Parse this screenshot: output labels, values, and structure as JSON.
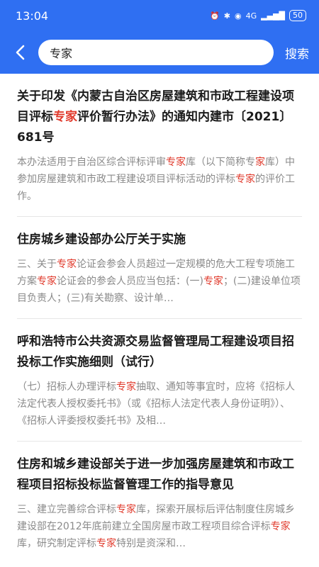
{
  "status": {
    "time": "13:04",
    "battery": "50",
    "network": "4G"
  },
  "search": {
    "value": "专家",
    "button": "搜索"
  },
  "results": [
    {
      "title_parts": [
        "关于印发《内蒙古自治区房屋建筑和市政工程建设项目评标",
        "专家",
        "评价暂行办法》的通知内建市〔2021〕681号"
      ],
      "snippet_parts": [
        "本办法适用于自治区综合评标评审",
        "专家",
        "库（以下简称专",
        "家",
        "库）中参加房屋建筑和市政工程建设项目评标活动的评标",
        "专家",
        "的评价工作。"
      ]
    },
    {
      "title_parts": [
        "住房城乡建设部办公厅关于实施"
      ],
      "snippet_parts": [
        "三、关于",
        "专家",
        "论证会参会人员超过一定规模的危大工程专项施工方案",
        "专家",
        "论证会的参会人员应当包括：(一)",
        "专家",
        "；(二)建设单位项目负责人；(三)有关勘察、设计单…"
      ]
    },
    {
      "title_parts": [
        "呼和浩特市公共资源交易监督管理局工程建设项目招投标工作实施细则（试行）"
      ],
      "snippet_parts": [
        "（七）招标人办理评标",
        "专家",
        "抽取、通知等事宜时，应将《招标人法定代表人授权委托书》（或《招标人法定代表人身份证明》）、《招标人评委授权委托书》及相…"
      ]
    },
    {
      "title_parts": [
        "住房和城乡建设部关于进一步加强房屋建筑和市政工程项目招标投标监督管理工作的指导意见"
      ],
      "snippet_parts": [
        "三、建立完善综合评标",
        "专家",
        "库，探索开展标后评估制度住房城乡建设部在2012年底前建立全国房屋市政工程项目综合评标",
        "专家",
        "库，研究制定评标",
        "专家",
        "特别是资深和…"
      ]
    }
  ],
  "colors": {
    "brand": "#2f6ff2",
    "highlight": "#e0392b"
  }
}
